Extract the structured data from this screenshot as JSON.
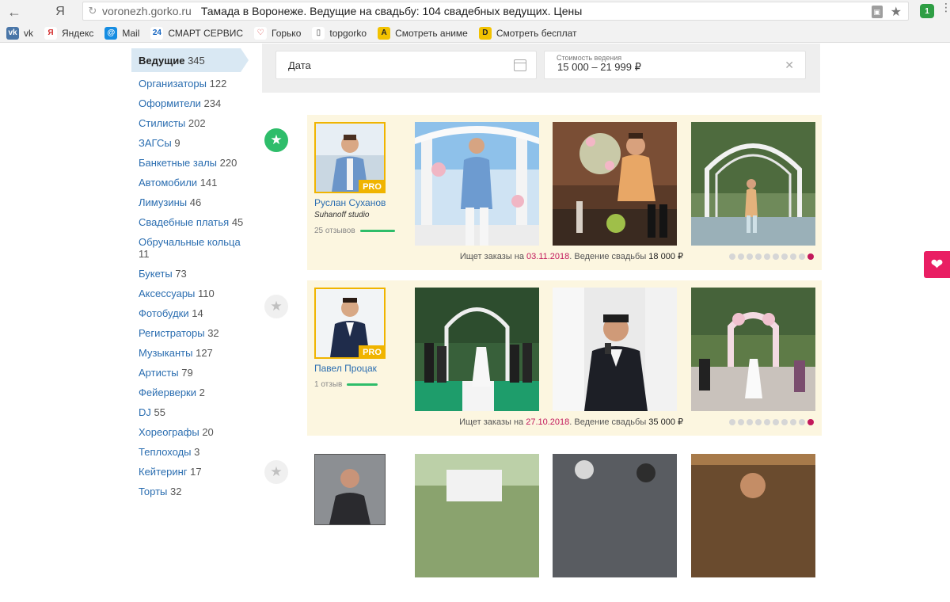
{
  "browser": {
    "domain": "voronezh.gorko.ru",
    "page_title": "Тамада в Воронеже. Ведущие на свадьбу: 104 свадебных ведущих. Цены",
    "back": "←",
    "brand_glyph": "Я",
    "extension_badge": "1",
    "bookmarks": [
      {
        "label": "vk",
        "icon": "vk-icon",
        "color": "#4a76a8",
        "glyph": "vk"
      },
      {
        "label": "Яндекс",
        "icon": "yandex-icon",
        "color": "#ffffff",
        "glyph": "Я"
      },
      {
        "label": "Mail",
        "icon": "mail-icon",
        "color": "#168de2",
        "glyph": "@"
      },
      {
        "label": "СМАРТ СЕРВИС",
        "icon": "smart-service-icon",
        "color": "#ffffff",
        "glyph": "24"
      },
      {
        "label": "Горько",
        "icon": "gorko-icon",
        "color": "#ffffff",
        "glyph": "♡"
      },
      {
        "label": "topgorko",
        "icon": "page-icon",
        "color": "#ffffff",
        "glyph": "▯"
      },
      {
        "label": "Смотреть аниме",
        "icon": "anime-icon",
        "color": "#f2c200",
        "glyph": "A"
      },
      {
        "label": "Смотреть бесплат",
        "icon": "film-icon",
        "color": "#f2c200",
        "glyph": "D"
      }
    ]
  },
  "sidebar": {
    "items": [
      {
        "label": "Ведущие",
        "count": "345",
        "active": true
      },
      {
        "label": "Организаторы",
        "count": "122"
      },
      {
        "label": "Оформители",
        "count": "234"
      },
      {
        "label": "Стилисты",
        "count": "202"
      },
      {
        "label": "ЗАГСы",
        "count": "9"
      },
      {
        "label": "Банкетные залы",
        "count": "220"
      },
      {
        "label": "Автомобили",
        "count": "141"
      },
      {
        "label": "Лимузины",
        "count": "46"
      },
      {
        "label": "Свадебные платья",
        "count": "45"
      },
      {
        "label": "Обручальные кольца",
        "count": "11",
        "two_lines": true
      },
      {
        "label": "Букеты",
        "count": "73"
      },
      {
        "label": "Аксессуары",
        "count": "110"
      },
      {
        "label": "Фотобудки",
        "count": "14"
      },
      {
        "label": "Регистраторы",
        "count": "32"
      },
      {
        "label": "Музыканты",
        "count": "127"
      },
      {
        "label": "Артисты",
        "count": "79"
      },
      {
        "label": "Фейерверки",
        "count": "2"
      },
      {
        "label": "DJ",
        "count": "55"
      },
      {
        "label": "Хореографы",
        "count": "20"
      },
      {
        "label": "Теплоходы",
        "count": "3"
      },
      {
        "label": "Кейтеринг",
        "count": "17"
      },
      {
        "label": "Торты",
        "count": "32"
      }
    ]
  },
  "filters": {
    "date_placeholder": "Дата",
    "cost_label": "Стоимость ведения",
    "cost_value": "15 000 – 21 999 ₽",
    "clear": "✕"
  },
  "cards": [
    {
      "favorite": true,
      "pro": "PRO",
      "name": "Руслан Суханов",
      "studio": "Suhanoff studio",
      "reviews": "25 отзывов",
      "review_level": 0.85,
      "status_prefix": "Ищет заказы на",
      "status_date": "03.11.2018",
      "status_middle": ". Ведение свадьбы",
      "status_price": "18 000 ₽",
      "dots_total": 10,
      "dots_active": 9
    },
    {
      "favorite": false,
      "pro": "PRO",
      "name": "Павел Процак",
      "studio": "",
      "reviews": "1 отзыв",
      "review_level": 0.75,
      "status_prefix": "Ищет заказы на",
      "status_date": "27.10.2018",
      "status_middle": ". Ведение свадьбы",
      "status_price": "35 000 ₽",
      "dots_total": 10,
      "dots_active": 9
    },
    {
      "favorite": false,
      "pro": "",
      "name": "",
      "studio": "",
      "reviews": "",
      "review_level": 0,
      "status_prefix": "",
      "status_date": "",
      "status_middle": "",
      "status_price": "",
      "dots_total": 0,
      "dots_active": -1
    }
  ],
  "colors": {
    "accent_green": "#2ebd6a",
    "accent_pink": "#c2185b",
    "pro_yellow": "#f0b400",
    "card_bg": "#fcf6e0",
    "link_blue": "#2a6db0"
  },
  "icons": {
    "favorite_on": "star-icon",
    "favorite_off": "star-outline-icon",
    "heart_tab": "heart-icon",
    "calendar": "calendar-icon"
  }
}
